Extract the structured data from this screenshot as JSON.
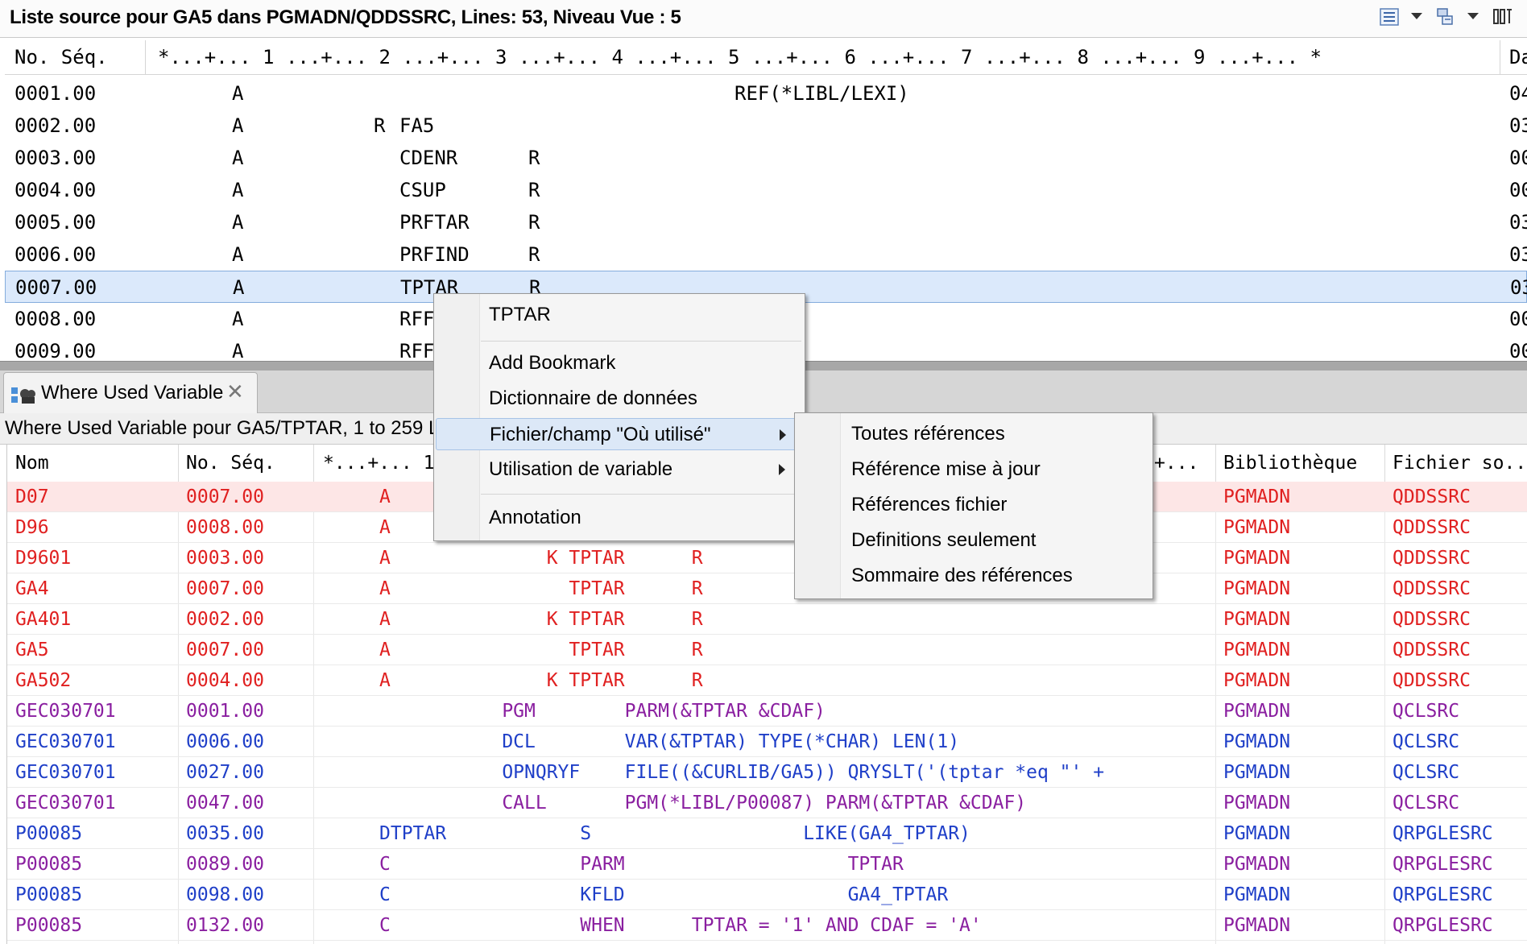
{
  "editor": {
    "title": "Liste source pour GA5 dans PGMADN/QDDSSRC, Lines: 53, Niveau Vue : 5",
    "header": {
      "seq": "No. Séq.",
      "ruler": "*...+... 1 ...+... 2 ...+... 3 ...+... 4 ...+... 5 ...+... 6 ...+... 7 ...+... 8 ...+... 9 ...+... *",
      "date": "Da"
    },
    "rows": [
      {
        "seq": "0001.00",
        "a": "A",
        "r": "",
        "name": "",
        "ref": "",
        "func": "REF(*LIBL/LEXI)",
        "date": "04"
      },
      {
        "seq": "0002.00",
        "a": "A",
        "r": "R",
        "name": "FA5",
        "ref": "",
        "func": "",
        "date": "03"
      },
      {
        "seq": "0003.00",
        "a": "A",
        "r": "",
        "name": "CDENR",
        "ref": "R",
        "func": "",
        "date": "00"
      },
      {
        "seq": "0004.00",
        "a": "A",
        "r": "",
        "name": "CSUP",
        "ref": "R",
        "func": "",
        "date": "00"
      },
      {
        "seq": "0005.00",
        "a": "A",
        "r": "",
        "name": "PRFTAR",
        "ref": "R",
        "func": "",
        "date": "03"
      },
      {
        "seq": "0006.00",
        "a": "A",
        "r": "",
        "name": "PRFIND",
        "ref": "R",
        "func": "",
        "date": "03"
      },
      {
        "seq": "0007.00",
        "a": "A",
        "r": "",
        "name": "TPTAR",
        "ref": "R",
        "func": "",
        "date": "03"
      },
      {
        "seq": "0008.00",
        "a": "A",
        "r": "",
        "name": "RFF",
        "ref": "",
        "func": "",
        "date": "00"
      },
      {
        "seq": "0009.00",
        "a": "A",
        "r": "",
        "name": "RFF",
        "ref": "",
        "func": "",
        "date": "00"
      }
    ]
  },
  "view": {
    "tab_label": "Where Used Variable",
    "status": "Where Used Variable pour GA5/TPTAR, 1 to 259 Lir",
    "columns": {
      "nom": "Nom",
      "seq": "No. Séq.",
      "ruler": "*...+... 1",
      "ruler_end": "+...",
      "lib": "Bibliothèque",
      "file": "Fichier so..."
    },
    "rows": [
      {
        "nom": "D07",
        "seq": "0007.00",
        "src": "A",
        "lib": "PGMADN",
        "file": "QDDSSRC",
        "color": "red"
      },
      {
        "nom": "D96",
        "seq": "0008.00",
        "src": "A",
        "lib": "PGMADN",
        "file": "QDDSSRC",
        "color": "red"
      },
      {
        "nom": "D9601",
        "seq": "0003.00",
        "src": "A              K TPTAR      R",
        "lib": "PGMADN",
        "file": "QDDSSRC",
        "color": "red"
      },
      {
        "nom": "GA4",
        "seq": "0007.00",
        "src": "A                TPTAR      R",
        "lib": "PGMADN",
        "file": "QDDSSRC",
        "color": "red"
      },
      {
        "nom": "GA401",
        "seq": "0002.00",
        "src": "A              K TPTAR      R",
        "lib": "PGMADN",
        "file": "QDDSSRC",
        "color": "red"
      },
      {
        "nom": "GA5",
        "seq": "0007.00",
        "src": "A                TPTAR      R",
        "lib": "PGMADN",
        "file": "QDDSSRC",
        "color": "red"
      },
      {
        "nom": "GA502",
        "seq": "0004.00",
        "src": "A              K TPTAR      R",
        "lib": "PGMADN",
        "file": "QDDSSRC",
        "color": "red"
      },
      {
        "nom": "GEC030701",
        "seq": "0001.00",
        "src": "           PGM        PARM(&TPTAR &CDAF)",
        "lib": "PGMADN",
        "file": "QCLSRC",
        "color": "purple"
      },
      {
        "nom": "GEC030701",
        "seq": "0006.00",
        "src": "           DCL        VAR(&TPTAR) TYPE(*CHAR) LEN(1)",
        "lib": "PGMADN",
        "file": "QCLSRC",
        "color": "blue"
      },
      {
        "nom": "GEC030701",
        "seq": "0027.00",
        "src": "           OPNQRYF    FILE((&CURLIB/GA5)) QRYSLT('(tptar *eq \"' +",
        "lib": "PGMADN",
        "file": "QCLSRC",
        "color": "blue"
      },
      {
        "nom": "GEC030701",
        "seq": "0047.00",
        "src": "           CALL       PGM(*LIBL/P00087) PARM(&TPTAR &CDAF)",
        "lib": "PGMADN",
        "file": "QCLSRC",
        "color": "purple"
      },
      {
        "nom": "P00085",
        "seq": "0035.00",
        "src": "DTPTAR            S                   LIKE(GA4_TPTAR)",
        "lib": "PGMADN",
        "file": "QRPGLESRC",
        "color": "blue"
      },
      {
        "nom": "P00085",
        "seq": "0089.00",
        "src": "C                 PARM                    TPTAR",
        "lib": "PGMADN",
        "file": "QRPGLESRC",
        "color": "purple"
      },
      {
        "nom": "P00085",
        "seq": "0098.00",
        "src": "C                 KFLD                    GA4_TPTAR",
        "lib": "PGMADN",
        "file": "QRPGLESRC",
        "color": "blue"
      },
      {
        "nom": "P00085",
        "seq": "0132.00",
        "src": "C                 WHEN      TPTAR = '1' AND CDAF = 'A'",
        "lib": "PGMADN",
        "file": "QRPGLESRC",
        "color": "purple"
      }
    ]
  },
  "context_menu": {
    "header": "TPTAR",
    "items": [
      "Add Bookmark",
      "Dictionnaire de données",
      "Fichier/champ \"Où utilisé\"",
      "Utilisation de variable",
      "Annotation"
    ]
  },
  "submenu": {
    "items": [
      "Toutes références",
      "Référence mise à jour",
      "Références fichier",
      "Definitions seulement",
      "Sommaire des références"
    ]
  },
  "colors": {
    "red": "#e02020",
    "purple": "#8a1fa0",
    "blue": "#1f3fc8",
    "selection": "#dbe9fb"
  },
  "icons": [
    "outline-icon",
    "dropdown-icon",
    "filter-icon",
    "view-icon",
    "where-used-icon",
    "close-icon",
    "submenu-arrow-icon"
  ]
}
